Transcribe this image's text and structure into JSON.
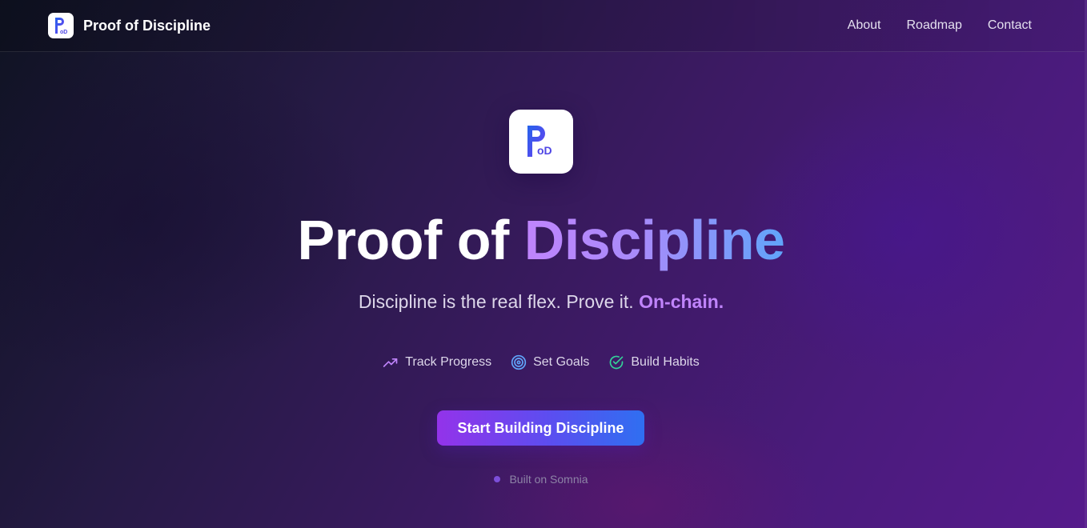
{
  "header": {
    "brand_name": "Proof of Discipline",
    "logo_icon": "pod-logo-icon",
    "nav_links": [
      "About",
      "Roadmap",
      "Contact"
    ]
  },
  "hero": {
    "logo_icon": "pod-logo-icon",
    "title_main": "Proof of ",
    "title_accent": "Discipline",
    "tagline_main": "Discipline is the real flex. Prove it. ",
    "tagline_accent": "On-chain.",
    "features": [
      {
        "label": "Track Progress",
        "icon": "trending-up-icon",
        "color": "#c084fc"
      },
      {
        "label": "Set Goals",
        "icon": "target-icon",
        "color": "#60a5fa"
      },
      {
        "label": "Build Habits",
        "icon": "check-circle-icon",
        "color": "#34d399"
      }
    ],
    "cta_label": "Start Building Discipline",
    "built_on": "Built on Somnia"
  },
  "colors": {
    "accent_purple": "#c084fc",
    "accent_blue": "#60a5fa",
    "cta_gradient_start": "#9333ea",
    "cta_gradient_end": "#2f6ff1",
    "background_dark": "#0f1322",
    "background_purple": "#561b8c"
  }
}
